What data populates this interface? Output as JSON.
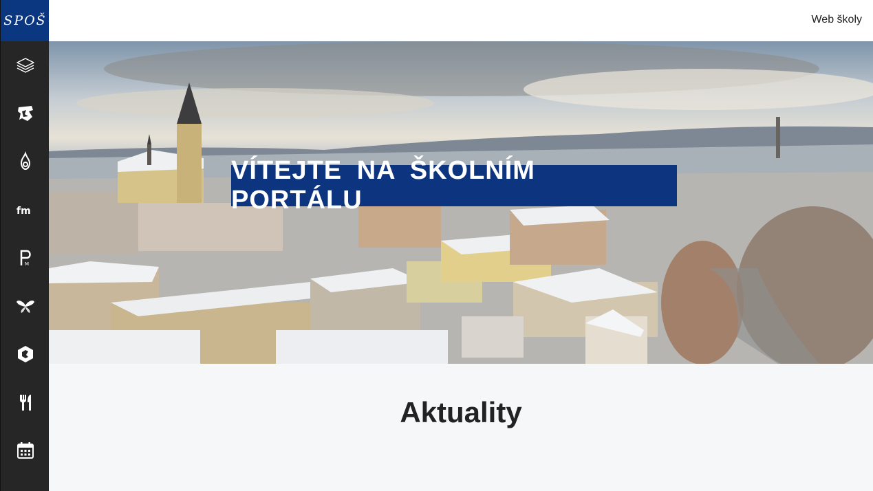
{
  "app": {
    "logo_text": "SPOŠ"
  },
  "sidebar": {
    "items": [
      {
        "icon": "layers-icon"
      },
      {
        "icon": "mascot-icon"
      },
      {
        "icon": "flame-icon"
      },
      {
        "icon": "fm-icon"
      },
      {
        "icon": "pm-icon"
      },
      {
        "icon": "butterfly-icon"
      },
      {
        "icon": "hexagon-logo-icon"
      },
      {
        "icon": "cutlery-icon"
      },
      {
        "icon": "calendar-icon"
      }
    ]
  },
  "header": {
    "web_link": "Web školy"
  },
  "hero": {
    "title": "VÍTEJTE NA ŠKOLNÍM PORTÁLU",
    "image": "snowy-town-panorama"
  },
  "main": {
    "section_title": "Aktuality"
  },
  "colors": {
    "brand_blue": "#0d357f",
    "sidebar_bg": "#262626",
    "page_bg": "#f6f7f9"
  }
}
